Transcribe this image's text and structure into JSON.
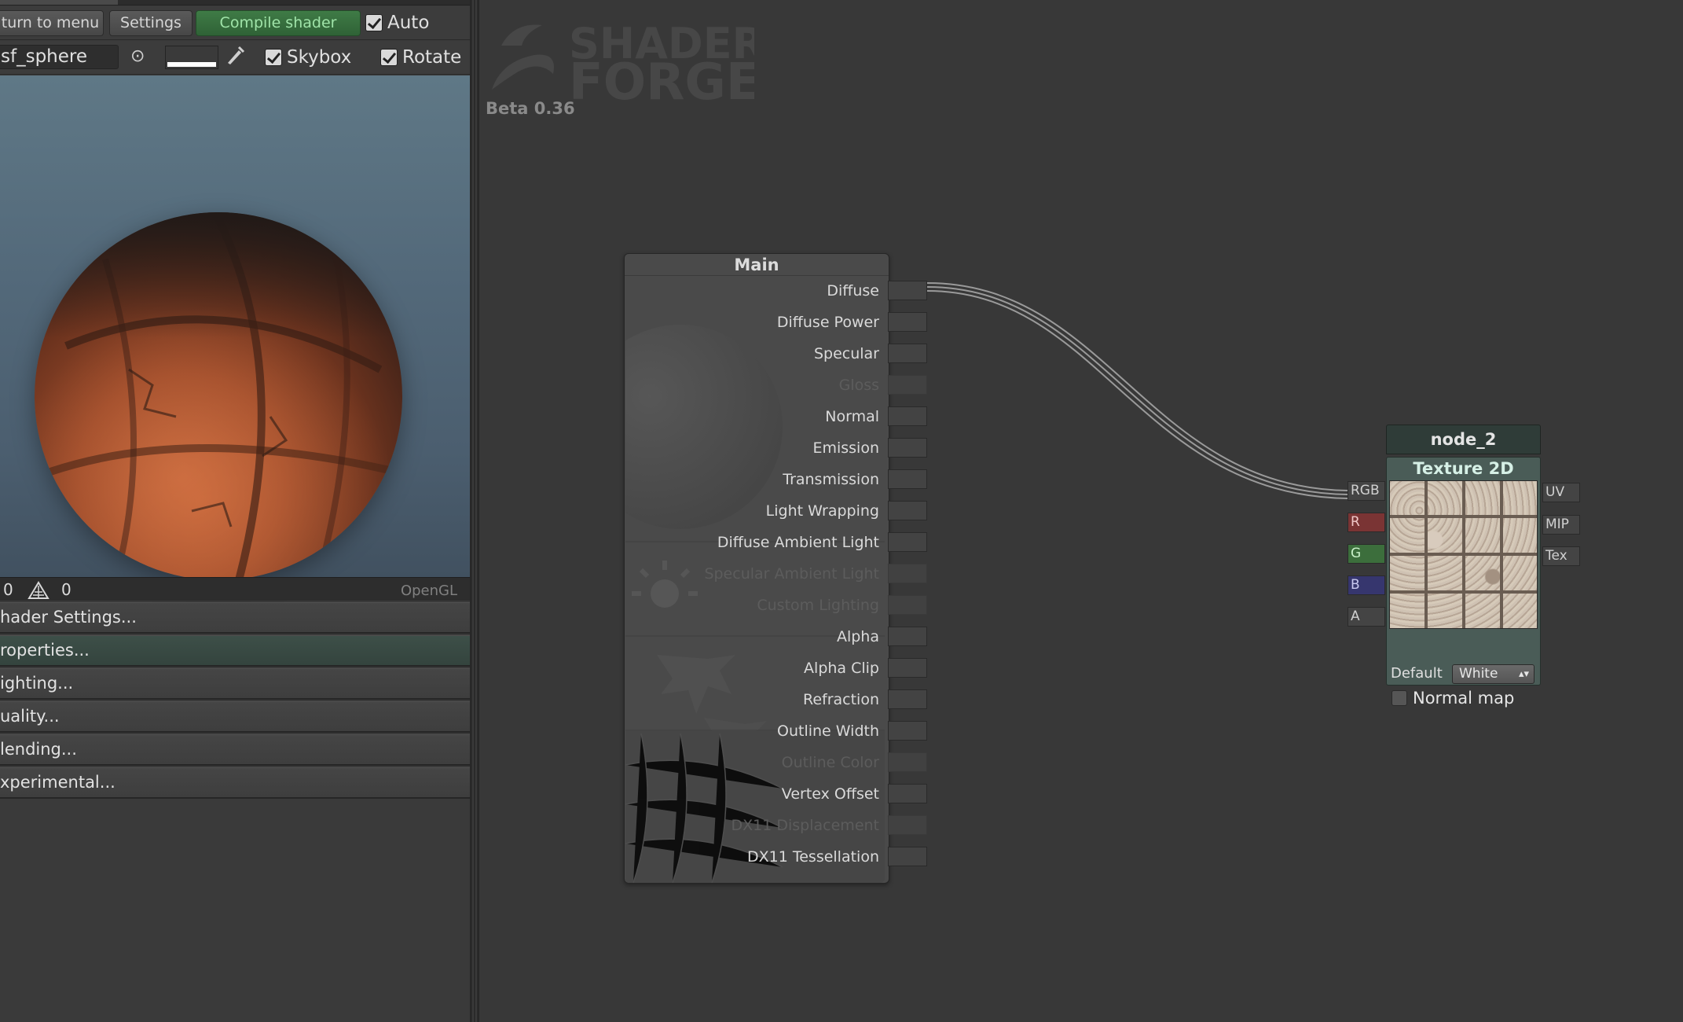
{
  "toolbar": {
    "return_label": "turn to menu",
    "settings_label": "Settings",
    "compile_label": "Compile shader",
    "auto_label": "Auto",
    "auto_checked": true
  },
  "preview_toolbar": {
    "mesh_value": "sf_sphere",
    "skybox_label": "Skybox",
    "skybox_checked": true,
    "rotate_label": "Rotate",
    "rotate_checked": true
  },
  "status": {
    "vertex_count": "0",
    "tri_count": "0",
    "api": "OpenGL"
  },
  "panels": [
    {
      "label": "hader Settings..."
    },
    {
      "label": "roperties..."
    },
    {
      "label": "ighting..."
    },
    {
      "label": "uality..."
    },
    {
      "label": "lending..."
    },
    {
      "label": "xperimental..."
    }
  ],
  "logo": {
    "line1": "SHADER",
    "line2": "FORGE"
  },
  "version": "Beta 0.36",
  "main_node": {
    "title": "Main",
    "inputs": [
      {
        "label": "Diffuse",
        "enabled": true
      },
      {
        "label": "Diffuse Power",
        "enabled": true
      },
      {
        "label": "Specular",
        "enabled": true
      },
      {
        "label": "Gloss",
        "enabled": false
      },
      {
        "label": "Normal",
        "enabled": true
      },
      {
        "label": "Emission",
        "enabled": true
      },
      {
        "label": "Transmission",
        "enabled": true
      },
      {
        "label": "Light Wrapping",
        "enabled": true
      },
      {
        "label": "Diffuse Ambient Light",
        "enabled": true
      },
      {
        "label": "Specular Ambient Light",
        "enabled": false
      },
      {
        "label": "Custom Lighting",
        "enabled": false
      },
      {
        "label": "Alpha",
        "enabled": true
      },
      {
        "label": "Alpha Clip",
        "enabled": true
      },
      {
        "label": "Refraction",
        "enabled": true
      },
      {
        "label": "Outline Width",
        "enabled": true
      },
      {
        "label": "Outline Color",
        "enabled": false
      },
      {
        "label": "Vertex Offset",
        "enabled": true
      },
      {
        "label": "DX11 Displacement",
        "enabled": false
      },
      {
        "label": "DX11 Tessellation",
        "enabled": true
      }
    ]
  },
  "texture_node": {
    "name": "node_2",
    "title": "Texture 2D",
    "outputs": [
      "RGB",
      "R",
      "G",
      "B",
      "A"
    ],
    "inputs": [
      "UV",
      "MIP",
      "Tex"
    ],
    "default_label": "Default",
    "default_value": "White",
    "normal_map_label": "Normal map",
    "normal_map_checked": false
  },
  "colors": {
    "port_r": "#7a3434",
    "port_g": "#3c6e3c",
    "port_b": "#36366e",
    "port_a": "#444444",
    "port_rgb": "#444444",
    "compile_green": "#3f7b46"
  }
}
